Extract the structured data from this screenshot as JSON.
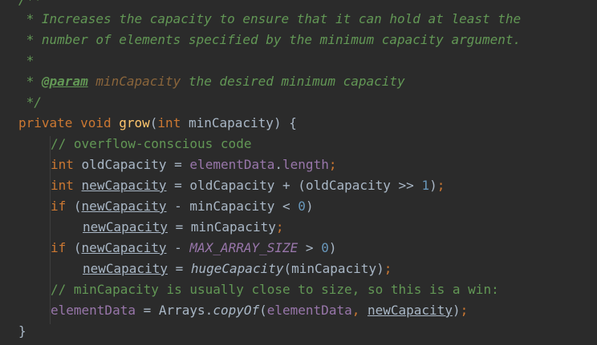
{
  "code": {
    "doc_open": "/**",
    "doc_line1": " * Increases the capacity to ensure that it can hold at least the",
    "doc_line2": " * number of elements specified by the minimum capacity argument.",
    "doc_star": " *",
    "doc_param_prefix": " * ",
    "doc_param_tag": "@param",
    "doc_param_name": "minCapacity",
    "doc_param_desc": " the desired minimum capacity",
    "doc_close": " */",
    "kw_private": "private",
    "kw_void": "void",
    "kw_int": "int",
    "kw_if": "if",
    "method_name": "grow",
    "param_minCapacity": "minCapacity",
    "comment_overflow": "// overflow-conscious code",
    "var_oldCapacity": "oldCapacity",
    "var_newCapacity": "newCapacity",
    "var_minCapacity": "minCapacity",
    "field_elementData": "elementData",
    "field_length": "length",
    "const_max": "MAX_ARRAY_SIZE",
    "fn_hugeCapacity": "hugeCapacity",
    "class_arrays": "Arrays",
    "fn_copyOf": "copyOf",
    "num_1": "1",
    "num_0": "0",
    "comment_win": "// minCapacity is usually close to size, so this is a win:",
    "punct_open_paren": "(",
    "punct_close_paren": ")",
    "punct_open_brace": " {",
    "punct_close_brace": "}",
    "punct_semicolon": ";",
    "punct_dot": ".",
    "punct_comma": ", ",
    "op_assign": " = ",
    "op_plus": " + ",
    "op_minus": " - ",
    "op_lt": " < ",
    "op_gt": " > ",
    "op_shift": " >> ",
    "space": " "
  },
  "colors": {
    "background": "#2B2B2B",
    "doc_comment": "#629755",
    "keyword": "#CC7832",
    "method": "#FFC66D",
    "field": "#9876AA",
    "number": "#6897BB",
    "line_comment": "#808080",
    "text": "#A9B7C6"
  }
}
